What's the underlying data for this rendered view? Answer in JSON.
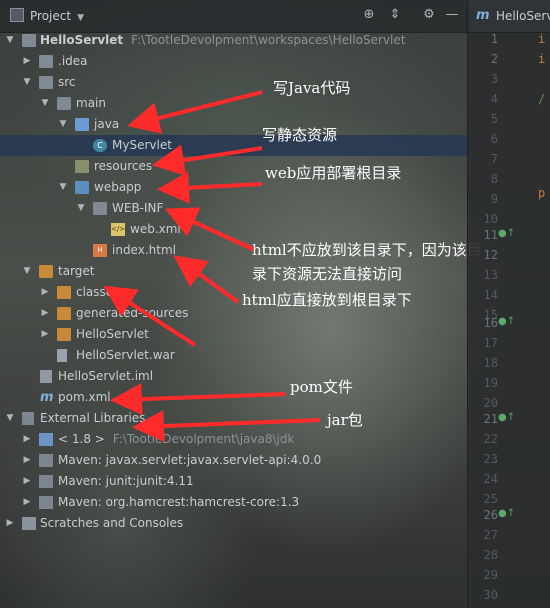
{
  "project_panel": {
    "title": "Project",
    "tree": [
      {
        "label": "HelloServlet",
        "path": "F:\\TootleDevolpment\\workspaces\\HelloServlet",
        "bold": true
      },
      {
        "label": ".idea"
      },
      {
        "label": "src"
      },
      {
        "label": "main"
      },
      {
        "label": "java"
      },
      {
        "label": "MyServlet"
      },
      {
        "label": "resources"
      },
      {
        "label": "webapp"
      },
      {
        "label": "WEB-INF"
      },
      {
        "label": "web.xml"
      },
      {
        "label": "index.html"
      },
      {
        "label": "target"
      },
      {
        "label": "classes"
      },
      {
        "label": "generated-sources"
      },
      {
        "label": "HelloServlet"
      },
      {
        "label": "HelloServlet.war"
      },
      {
        "label": "HelloServlet.iml"
      },
      {
        "label": "pom.xml"
      },
      {
        "label": "External Libraries"
      },
      {
        "label": "< 1.8 >",
        "path": "F:\\TootleDevolpment\\java8\\jdk"
      },
      {
        "label": "Maven: javax.servlet:javax.servlet-api:4.0.0"
      },
      {
        "label": "Maven: junit:junit:4.11"
      },
      {
        "label": "Maven: org.hamcrest:hamcrest-core:1.3"
      },
      {
        "label": "Scratches and Consoles"
      }
    ]
  },
  "annotations": {
    "java_code": "写Java代码",
    "static_resources": "写静态资源",
    "web_root": "web应用部署根目录",
    "html_not_here_1": "html不应放到该目录下，因为该目",
    "html_not_here_2": "录下资源无法直接访问",
    "html_root": "html应直接放到根目录下",
    "pom": "pom文件",
    "jar": "jar包"
  },
  "editor": {
    "tab_label": "HelloServ",
    "line_numbers": [
      "1",
      "2",
      "3",
      "4",
      "5",
      "6",
      "7",
      "8",
      "9",
      "10",
      "11",
      "12",
      "13",
      "14",
      "15",
      "16",
      "17",
      "18",
      "19",
      "20",
      "21",
      "22",
      "23",
      "24",
      "25",
      "26",
      "27",
      "28",
      "29",
      "30"
    ],
    "code_fragments": [
      "i",
      "i",
      "/",
      "p"
    ]
  },
  "colors": {
    "selection": "#283a52",
    "annotation_arrow": "#ff2a2a",
    "annotation_text": "#ffffff"
  }
}
